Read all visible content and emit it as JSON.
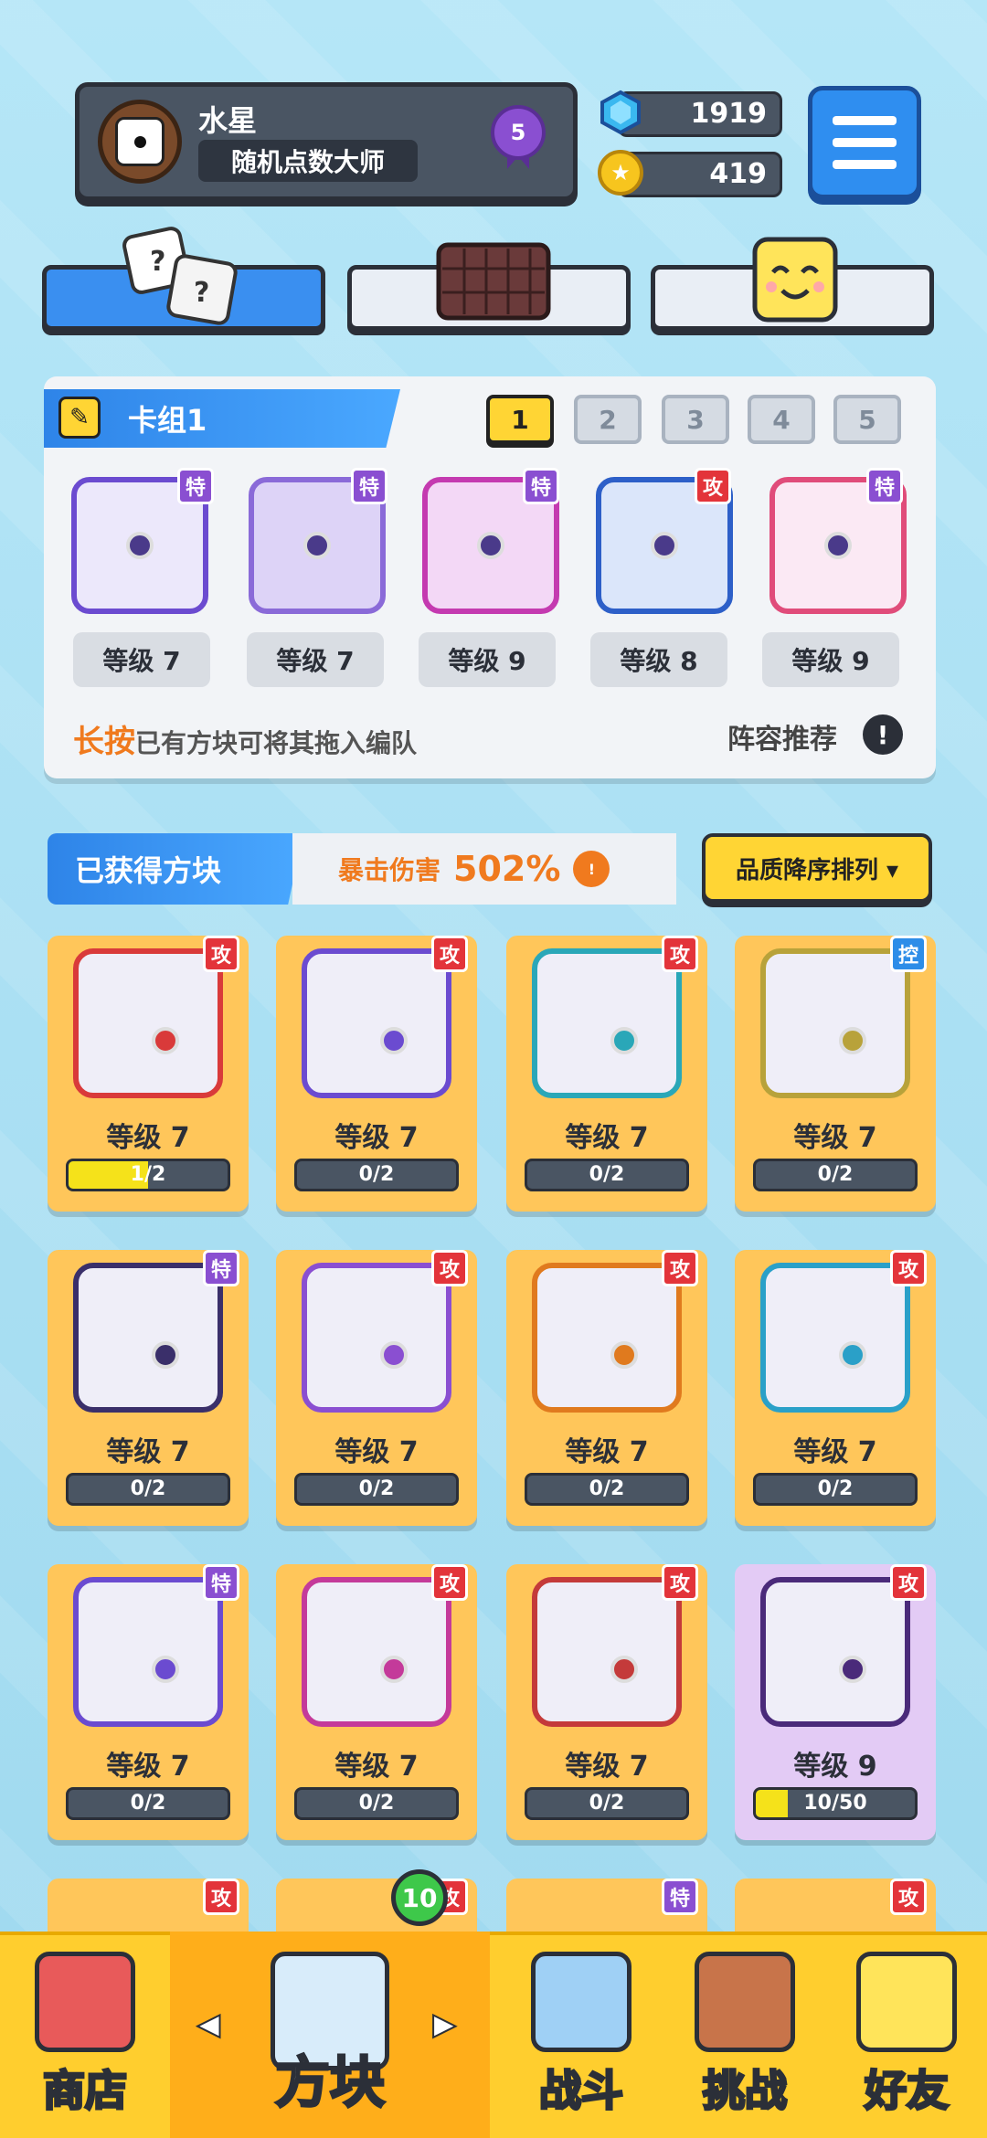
{
  "profile": {
    "name": "水星",
    "title": "随机点数大师",
    "rank": "5"
  },
  "currency": {
    "gems": "1919",
    "coins": "419"
  },
  "deck": {
    "title": "卡组1",
    "slots": [
      "1",
      "2",
      "3",
      "4",
      "5"
    ],
    "active_slot": 0,
    "cards": [
      {
        "type": "特",
        "level": "等级 7"
      },
      {
        "type": "特",
        "level": "等级 7"
      },
      {
        "type": "特",
        "level": "等级 9"
      },
      {
        "type": "攻",
        "level": "等级 8"
      },
      {
        "type": "特",
        "level": "等级 9"
      }
    ],
    "hint_strong": "长按",
    "hint_rest": "已有方块可将其拖入编队",
    "recommend": "阵容推荐",
    "recommend_icon": "!"
  },
  "owned": {
    "header": "已获得方块",
    "crit_label": "暴击伤害",
    "crit_value": "502%",
    "sort_label": "品质降序排列 ▾",
    "cards": [
      {
        "type": "攻",
        "level": "等级 7",
        "progress": "1/2",
        "fill": 0.5,
        "color": "#d93a3a"
      },
      {
        "type": "攻",
        "level": "等级 7",
        "progress": "0/2",
        "fill": 0,
        "color": "#6b4bd0"
      },
      {
        "type": "攻",
        "level": "等级 7",
        "progress": "0/2",
        "fill": 0,
        "color": "#2aa7b8"
      },
      {
        "type": "控",
        "level": "等级 7",
        "progress": "0/2",
        "fill": 0,
        "color": "#b8a23a"
      },
      {
        "type": "特",
        "level": "等级 7",
        "progress": "0/2",
        "fill": 0,
        "color": "#3a2f6a"
      },
      {
        "type": "攻",
        "level": "等级 7",
        "progress": "0/2",
        "fill": 0,
        "color": "#8a4fd1"
      },
      {
        "type": "攻",
        "level": "等级 7",
        "progress": "0/2",
        "fill": 0,
        "color": "#e07a1e"
      },
      {
        "type": "攻",
        "level": "等级 7",
        "progress": "0/2",
        "fill": 0,
        "color": "#2aa0c8"
      },
      {
        "type": "特",
        "level": "等级 7",
        "progress": "0/2",
        "fill": 0,
        "color": "#6b4bd0"
      },
      {
        "type": "攻",
        "level": "等级 7",
        "progress": "0/2",
        "fill": 0,
        "color": "#c43a9a"
      },
      {
        "type": "攻",
        "level": "等级 7",
        "progress": "0/2",
        "fill": 0,
        "color": "#c43a3a"
      },
      {
        "type": "攻",
        "level": "等级 9",
        "progress": "10/50",
        "fill": 0.2,
        "color": "#4a2a7a",
        "epic": true
      }
    ],
    "partial_row_types": [
      "攻",
      "攻",
      "特",
      "攻"
    ]
  },
  "nav": {
    "shop": "商店",
    "blocks": "方块",
    "battle": "战斗",
    "challenge": "挑战",
    "friends": "好友",
    "blocks_badge": "10",
    "left_arrow": "◀",
    "right_arrow": "▶"
  }
}
